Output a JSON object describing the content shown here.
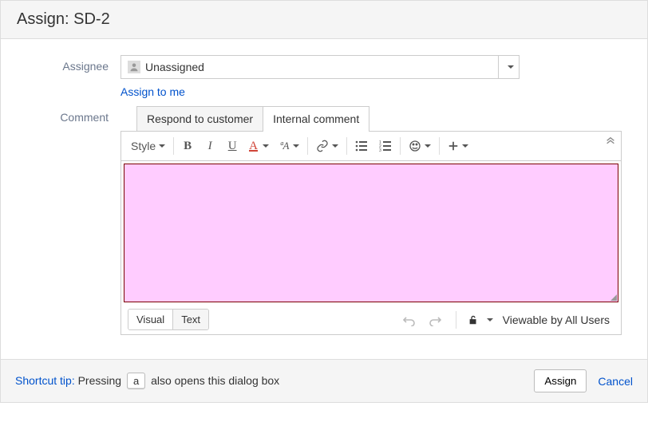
{
  "header": {
    "title": "Assign: SD-2"
  },
  "form": {
    "assignee_label": "Assignee",
    "assignee_value": "Unassigned",
    "assign_to_me": "Assign to me",
    "comment_label": "Comment"
  },
  "tabs": {
    "respond": "Respond to customer",
    "internal": "Internal comment"
  },
  "toolbar": {
    "style": "Style",
    "bold": "B",
    "italic": "I",
    "underline": "U",
    "color": "A",
    "clear": "ªA"
  },
  "editor_footer": {
    "visual": "Visual",
    "text": "Text",
    "visibility": "Viewable by All Users"
  },
  "footer": {
    "tip_label": "Shortcut tip:",
    "tip_before": " Pressing ",
    "tip_key": "a",
    "tip_after": " also opens this dialog box",
    "assign": "Assign",
    "cancel": "Cancel"
  }
}
